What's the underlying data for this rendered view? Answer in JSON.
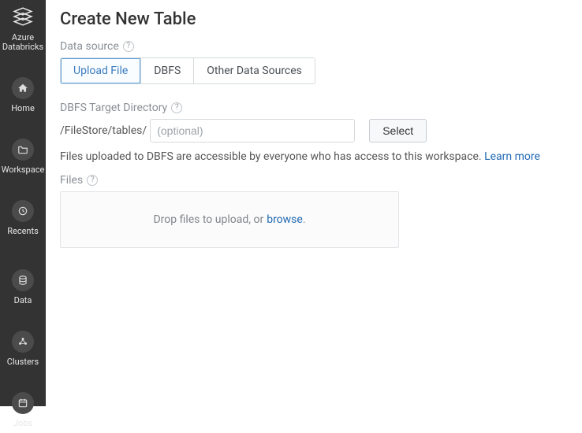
{
  "brand": {
    "name": "Azure Databricks"
  },
  "sidebar": {
    "items": [
      {
        "label": "Home"
      },
      {
        "label": "Workspace"
      },
      {
        "label": "Recents"
      },
      {
        "label": "Data"
      },
      {
        "label": "Clusters"
      },
      {
        "label": "Jobs"
      }
    ]
  },
  "page": {
    "title": "Create New Table"
  },
  "dataSource": {
    "label": "Data source",
    "tabs": [
      {
        "label": "Upload File"
      },
      {
        "label": "DBFS"
      },
      {
        "label": "Other Data Sources"
      }
    ]
  },
  "targetDir": {
    "label": "DBFS Target Directory",
    "path": "/FileStore/tables/",
    "placeholder": "(optional)",
    "selectLabel": "Select"
  },
  "note": {
    "text": "Files uploaded to DBFS are accessible by everyone who has access to this workspace.",
    "learnMore": "Learn more"
  },
  "files": {
    "label": "Files",
    "dropText": "Drop files to upload, or ",
    "browse": "browse"
  }
}
